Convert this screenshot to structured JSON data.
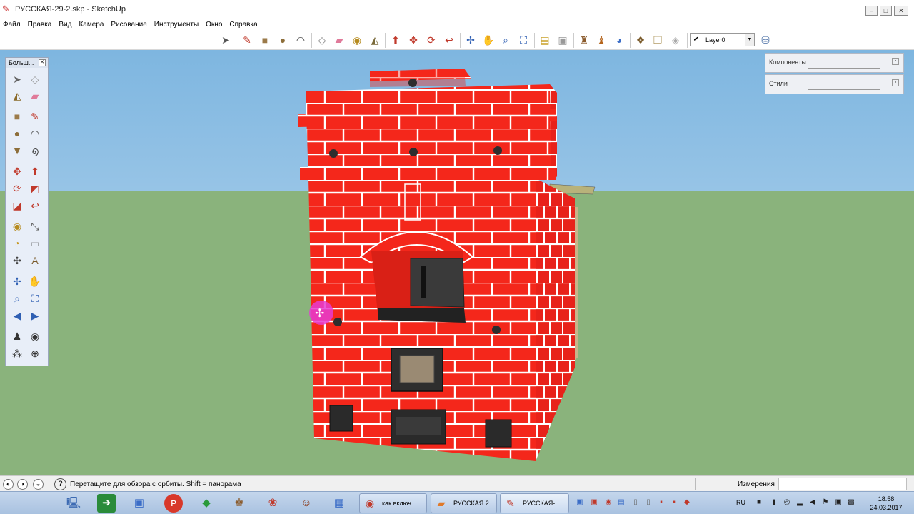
{
  "window": {
    "title": "РУССКАЯ-29-2.skp - SketchUp",
    "controls": {
      "minimize": "–",
      "maximize": "□",
      "close": "✕"
    }
  },
  "menubar": {
    "items": [
      {
        "label": "Файл"
      },
      {
        "label": "Правка"
      },
      {
        "label": "Вид"
      },
      {
        "label": "Камера"
      },
      {
        "label": "Рисование"
      },
      {
        "label": "Инструменты"
      },
      {
        "label": "Окно"
      },
      {
        "label": "Справка"
      }
    ]
  },
  "toolbar": {
    "icons": [
      "select-icon",
      "pencil-icon",
      "rectangle-icon",
      "circle-icon",
      "arc-icon",
      "make-component-icon",
      "eraser-icon",
      "tape-measure-icon",
      "paint-bucket-icon",
      "push-pull-icon",
      "move-icon",
      "rotate-icon",
      "offset-icon",
      "orbit-icon",
      "pan-icon",
      "zoom-icon",
      "zoom-extents-icon",
      "warehouse-icon",
      "share-model-icon",
      "get-models-icon",
      "components-icon",
      "extension-icon",
      "styles-icon",
      "layers-icon"
    ],
    "layer": {
      "check": "✔",
      "value": "Layer0"
    }
  },
  "palette": {
    "title": "Больш...",
    "close": "✕",
    "icons": [
      "select-icon",
      "make-component-icon",
      "paint-bucket-icon",
      "eraser-icon",
      "rectangle-icon",
      "line-icon",
      "circle-icon",
      "arc-icon",
      "polygon-icon",
      "freehand-icon",
      "move-icon",
      "push-pull-icon",
      "rotate-icon",
      "follow-me-icon",
      "scale-icon",
      "offset-icon",
      "tape-measure-icon",
      "dimension-icon",
      "protractor-icon",
      "text-icon",
      "axes-icon",
      "3d-text-icon",
      "orbit-icon",
      "pan-icon",
      "zoom-icon",
      "zoom-window-icon",
      "previous-view-icon",
      "next-view-icon",
      "position-camera-icon",
      "look-around-icon",
      "walk-icon",
      "section-plane-icon"
    ]
  },
  "tray": {
    "panels": [
      {
        "label": "Компоненты"
      },
      {
        "label": "Стили"
      }
    ]
  },
  "statusbar": {
    "hint": "Перетащите для обзора с орбиты.  Shift = панорама",
    "help": "?",
    "measurements_label": "Измерения",
    "measurements_value": ""
  },
  "taskbar": {
    "tasks": [
      {
        "label": "как включ..."
      },
      {
        "label": "РУССКАЯ 2..."
      },
      {
        "label": "РУССКАЯ-..."
      }
    ],
    "language": "RU",
    "time": "18:58",
    "date": "24.03.2017"
  },
  "colors": {
    "brick": "#f4271b",
    "mortar": "#ffffff",
    "sky_top": "#7eb6e0",
    "ground": "#8ab37c",
    "orbit_cursor": "#e63cd2"
  }
}
